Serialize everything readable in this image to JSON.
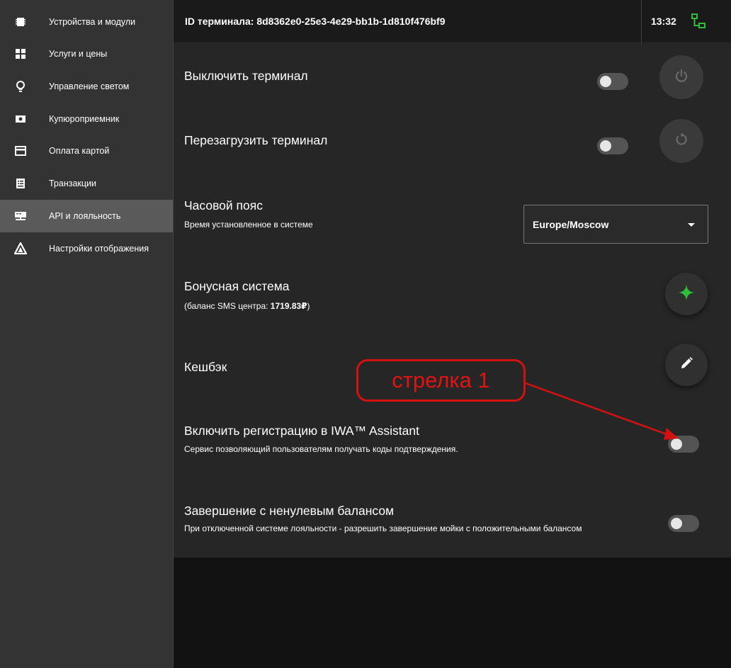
{
  "sidebar": {
    "items": [
      {
        "label": "Устройства и модули",
        "icon": "chip-icon"
      },
      {
        "label": "Услуги и цены",
        "icon": "grid-icon"
      },
      {
        "label": "Управление светом",
        "icon": "lightbulb-icon"
      },
      {
        "label": "Купюроприемник",
        "icon": "banknote-icon"
      },
      {
        "label": "Оплата картой",
        "icon": "credit-card-icon"
      },
      {
        "label": "Транзакции",
        "icon": "receipt-icon"
      },
      {
        "label": "API и лояльность",
        "icon": "api-icon",
        "active": true
      },
      {
        "label": "Настройки отображения",
        "icon": "display-settings-icon"
      }
    ]
  },
  "header": {
    "terminal_id": "ID терминала: 8d8362e0-25e3-4e29-bb1b-1d810f476bf9",
    "time": "13:32",
    "network_icon": "network-icon",
    "network_color": "#2fbf3a"
  },
  "rows": {
    "shutdown": {
      "title": "Выключить терминал",
      "toggle_on": false,
      "icon": "power-icon"
    },
    "reboot": {
      "title": "Перезагрузить терминал",
      "toggle_on": false,
      "icon": "restart-icon"
    },
    "timezone": {
      "title": "Часовой пояс",
      "subtitle": "Время установленное в системе",
      "value": "Europe/Moscow"
    },
    "bonus": {
      "title": "Бонусная система",
      "subtitle_prefix": "(баланс SMS центра: ",
      "balance": "1719.83₽",
      "subtitle_suffix": ")",
      "icon": "sparkle-icon",
      "icon_color": "#2fbf3a"
    },
    "cashback": {
      "title": "Кешбэк",
      "icon": "pencil-icon"
    },
    "iwa": {
      "title": "Включить регистрацию в IWA™ Assistant",
      "subtitle": "Сервис позволяющий пользователям получать коды подтверждения.",
      "toggle_on": false
    },
    "nonzero": {
      "title": "Завершение с ненулевым балансом",
      "subtitle": "При отключенной системе лояльности - разрешить завершение мойки с положительными балансом",
      "toggle_on": false
    }
  },
  "annotation": {
    "label": "стрелка 1",
    "color": "#d41111"
  }
}
